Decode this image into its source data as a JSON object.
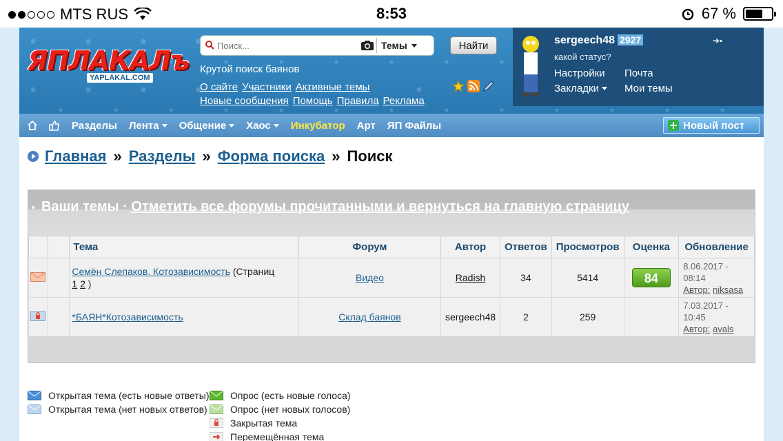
{
  "status_bar": {
    "carrier": "MTS RUS",
    "time": "8:53",
    "battery": "67 %"
  },
  "header": {
    "logo_text": "ЯПЛАКАЛъ",
    "logo_domain": "YAPLAKAL.COM",
    "search_placeholder": "Поиск...",
    "search_scope": "Темы",
    "find_button": "Найти",
    "tagline": "Крутой поиск баянов",
    "links": [
      "О сайте",
      "Участники",
      "Активные темы",
      "Новые сообщения",
      "Помощь",
      "Правила",
      "Реклама"
    ]
  },
  "user": {
    "name": "sergeech48",
    "count": "2927",
    "status": "какой статус?",
    "links": [
      "Настройки",
      "Почта",
      "Закладки",
      "Мои темы"
    ]
  },
  "navbar": {
    "items": [
      "Разделы",
      "Лента",
      "Общение",
      "Хаос",
      "Инкубатор",
      "Арт",
      "ЯП Файлы"
    ],
    "new_post": "Новый пост"
  },
  "breadcrumb": {
    "items": [
      "Главная",
      "Разделы",
      "Форма поиска"
    ],
    "current": "Поиск",
    "separator": "»"
  },
  "block": {
    "title": "Ваши темы",
    "dot": "·",
    "title_link": "Отметить все форумы прочитанными и вернуться на главную страницу"
  },
  "table": {
    "headers": [
      "Тема",
      "Форум",
      "Автор",
      "Ответов",
      "Просмотров",
      "Оценка",
      "Обновление"
    ],
    "rows": [
      {
        "icon": "envelope-icon",
        "topic": "Семён Слепаков. Котозависимость",
        "pages_label": "(Страниц",
        "page1": "1",
        "page2": "2",
        "pages_close": ")",
        "forum": "Видео",
        "author": "Radish",
        "replies": "34",
        "views": "5414",
        "rating": "84",
        "update_date": "8.06.2017 -",
        "update_time": "08:14",
        "update_author_label": "Автор:",
        "update_author": "niksasa"
      },
      {
        "icon": "lock-icon",
        "topic": "*БАЯН*Котозависимость",
        "forum": "Склад баянов",
        "author": "sergeech48",
        "replies": "2",
        "views": "259",
        "rating": "",
        "update_date": "7.03.2017 -",
        "update_time": "10:45",
        "update_author_label": "Автор:",
        "update_author": "avals"
      }
    ]
  },
  "legend": {
    "open_new": "Открытая тема (есть новые ответы)",
    "open_no_new": "Открытая тема (нет новых ответов)",
    "poll_new": "Опрос (есть новые голоса)",
    "poll_no_new": "Опрос (нет новых голосов)",
    "closed": "Закрытая тема",
    "moved": "Перемещённая тема"
  },
  "colors": {
    "header_blue": "#2a78b2",
    "nav_blue": "#5e9bd0",
    "link_blue": "#1b5f8f",
    "rating_green": "#6cba34",
    "incubator_yellow": "#ffe93b"
  }
}
